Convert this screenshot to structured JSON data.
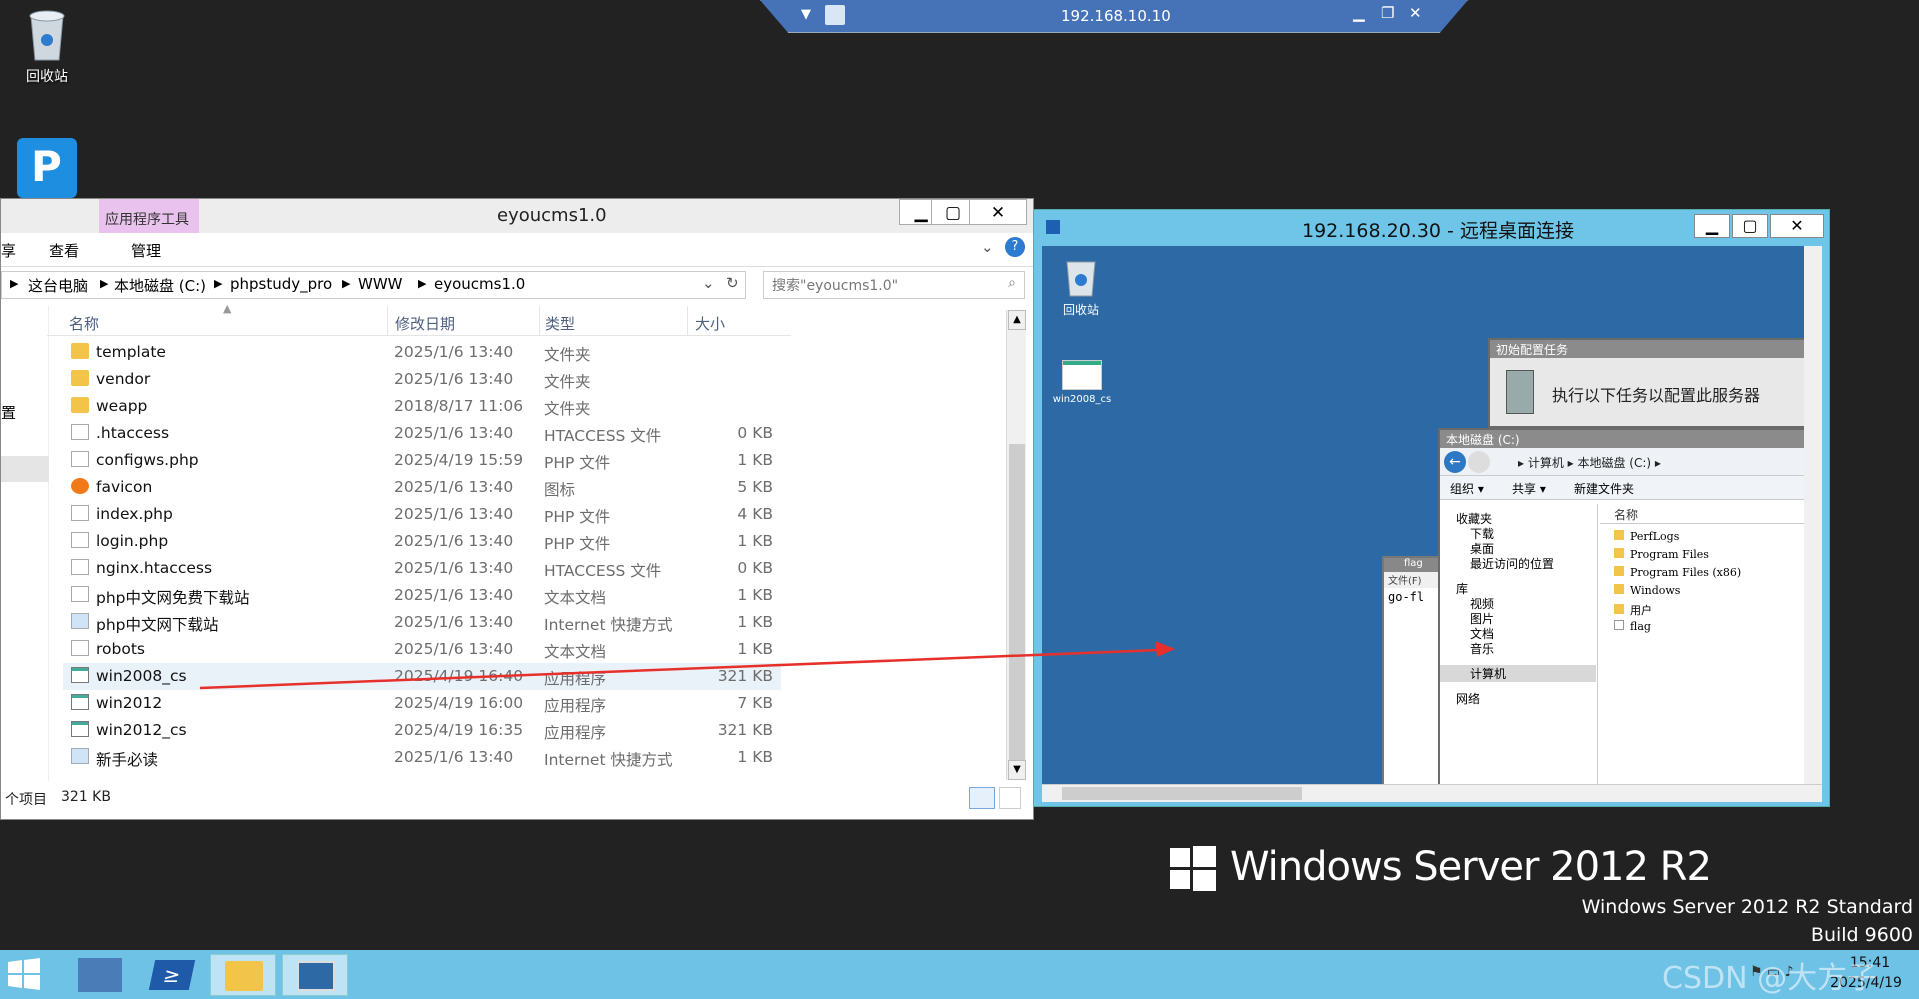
{
  "desktop": {
    "recycle_label": "回收站"
  },
  "rdp_bar": {
    "title": "192.168.10.10"
  },
  "explorer": {
    "ribbon_context": "应用程序工具",
    "window_title": "eyoucms1.0",
    "tabs": [
      "享",
      "查看",
      "管理"
    ],
    "breadcrumb": [
      "这台电脑",
      "本地磁盘 (C:)",
      "phpstudy_pro",
      "WWW",
      "eyoucms1.0"
    ],
    "search_placeholder": "搜索\"eyoucms1.0\"",
    "columns": {
      "name": "名称",
      "date": "修改日期",
      "type": "类型",
      "size": "大小"
    },
    "rows": [
      {
        "name": "template",
        "date": "2025/1/6 13:40",
        "type": "文件夹",
        "size": "",
        "icon": "folder-icon"
      },
      {
        "name": "vendor",
        "date": "2025/1/6 13:40",
        "type": "文件夹",
        "size": "",
        "icon": "folder-icon"
      },
      {
        "name": "weapp",
        "date": "2018/8/17 11:06",
        "type": "文件夹",
        "size": "",
        "icon": "folder-icon"
      },
      {
        "name": ".htaccess",
        "date": "2025/1/6 13:40",
        "type": "HTACCESS 文件",
        "size": "0 KB",
        "icon": "file-icon"
      },
      {
        "name": "configws.php",
        "date": "2025/4/19 15:59",
        "type": "PHP 文件",
        "size": "1 KB",
        "icon": "file-icon"
      },
      {
        "name": "favicon",
        "date": "2025/1/6 13:40",
        "type": "图标",
        "size": "5 KB",
        "icon": "favicon-icon"
      },
      {
        "name": "index.php",
        "date": "2025/1/6 13:40",
        "type": "PHP 文件",
        "size": "4 KB",
        "icon": "file-icon"
      },
      {
        "name": "login.php",
        "date": "2025/1/6 13:40",
        "type": "PHP 文件",
        "size": "1 KB",
        "icon": "file-icon"
      },
      {
        "name": "nginx.htaccess",
        "date": "2025/1/6 13:40",
        "type": "HTACCESS 文件",
        "size": "0 KB",
        "icon": "file-icon"
      },
      {
        "name": "php中文网免费下载站",
        "date": "2025/1/6 13:40",
        "type": "文本文档",
        "size": "1 KB",
        "icon": "file-icon"
      },
      {
        "name": "php中文网下载站",
        "date": "2025/1/6 13:40",
        "type": "Internet 快捷方式",
        "size": "1 KB",
        "icon": "shortcut-icon"
      },
      {
        "name": "robots",
        "date": "2025/1/6 13:40",
        "type": "文本文档",
        "size": "1 KB",
        "icon": "file-icon"
      },
      {
        "name": "win2008_cs",
        "date": "2025/4/19 16:40",
        "type": "应用程序",
        "size": "321 KB",
        "icon": "app-icon"
      },
      {
        "name": "win2012",
        "date": "2025/4/19 16:00",
        "type": "应用程序",
        "size": "7 KB",
        "icon": "app-icon"
      },
      {
        "name": "win2012_cs",
        "date": "2025/4/19 16:35",
        "type": "应用程序",
        "size": "321 KB",
        "icon": "app-icon"
      },
      {
        "name": "新手必读",
        "date": "2025/1/6 13:40",
        "type": "Internet 快捷方式",
        "size": "1 KB",
        "icon": "shortcut-icon"
      }
    ],
    "status_count": "个项目",
    "status_size": "321 KB",
    "nav_stub": "置"
  },
  "rdp_window": {
    "title": "192.168.20.30 - 远程桌面连接",
    "desktop_icons": [
      "回收站",
      "win2008_cs"
    ],
    "init_task_title": "初始配置任务",
    "init_task_text": "执行以下任务以配置此服务器",
    "local_disk_title": "本地磁盘 (C:)",
    "address": "▸ 计算机 ▸ 本地磁盘 (C:) ▸",
    "toolbar": [
      "组织 ▾",
      "共享 ▾",
      "新建文件夹"
    ],
    "nav_tree": [
      "收藏夹",
      "下载",
      "桌面",
      "最近访问的位置",
      "库",
      "视频",
      "图片",
      "文档",
      "音乐",
      "计算机",
      "网络"
    ],
    "list_header": "名称",
    "list_items": [
      "PerfLogs",
      "Program Files",
      "Program Files (x86)",
      "Windows",
      "用户",
      "flag"
    ],
    "flag_title": "flag",
    "flag_menu": "文件(F)",
    "flag_text": "go-fl"
  },
  "branding": {
    "logo": "Windows Server 2012 R2",
    "edition": "Windows Server 2012 R2 Standard",
    "build": "Build 9600"
  },
  "taskbar": {
    "time": "15:41",
    "date": "2025/4/19",
    "watermark": "CSDN @大方子"
  },
  "colors": {
    "taskbar": "#6dc2e6",
    "rdp_desktop": "#2d6aa5",
    "arrow": "#e8302a"
  }
}
